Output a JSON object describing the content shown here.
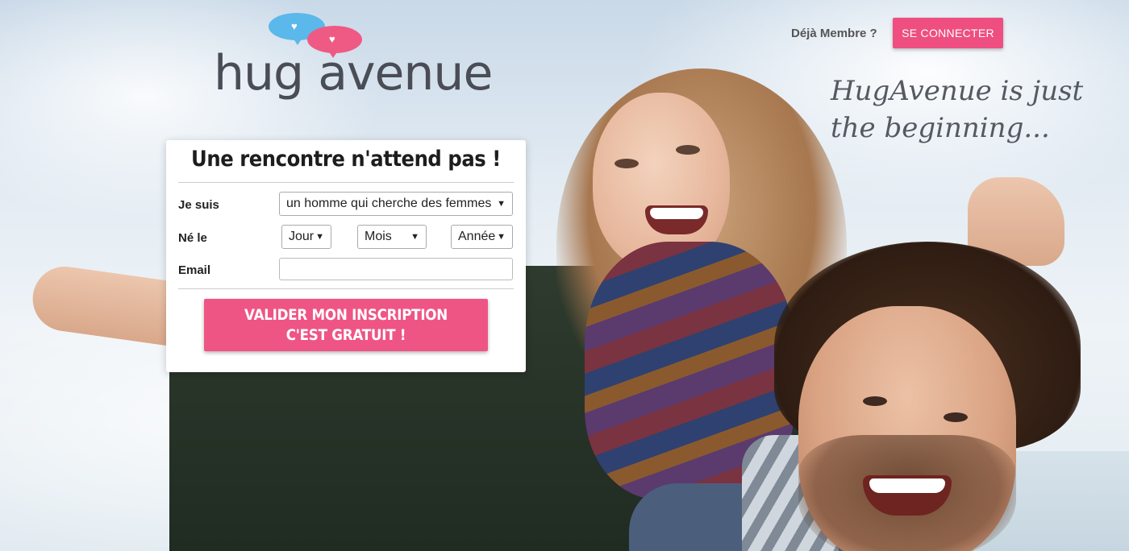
{
  "brand": {
    "name": "hug avenue",
    "pink": "#ee4f80",
    "blue": "#5bb8ea"
  },
  "header": {
    "member_text": "Déjà Membre ?",
    "connect_label": "SE CONNECTER",
    "tagline_line1": "HugAvenue is just",
    "tagline_line2": "the beginning..."
  },
  "form": {
    "title": "Une rencontre n'attend pas !",
    "je_suis_label": "Je suis",
    "je_suis_value": "un homme qui cherche des femmes",
    "ne_le_label": "Né le",
    "day_value": "Jour",
    "month_value": "Mois",
    "year_value": "Année",
    "email_label": "Email",
    "email_value": "",
    "submit_line1": "VALIDER MON INSCRIPTION",
    "submit_line2": "C'EST GRATUIT !"
  }
}
